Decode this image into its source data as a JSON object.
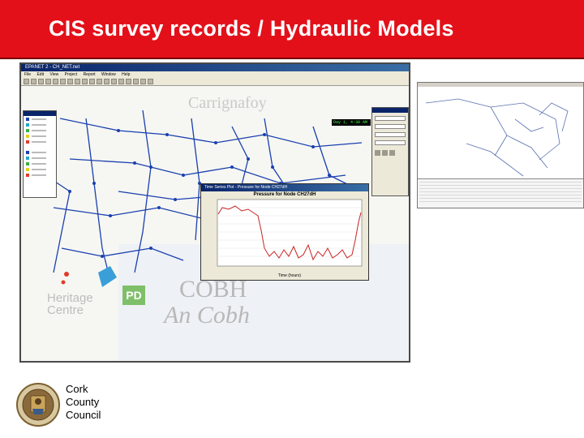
{
  "header": {
    "title": "CIS survey records / Hydraulic Models"
  },
  "app_window": {
    "title": "EPANET 2 - CH_NET.net",
    "menu": [
      "File",
      "Edit",
      "View",
      "Project",
      "Report",
      "Window",
      "Help"
    ],
    "status_readout": "Day 1, 4:30 AM",
    "plot_window_title": "Time Series Plot - Pressure for Node CH27dH",
    "plot_title": "Pressure for Node CH27dH",
    "plot_xlabel": "Time (hours)"
  },
  "map_labels": {
    "town_en": "COBH",
    "town_ga": "An Cobh",
    "heritage_line1": "Heritage",
    "heritage_line2": "Centre",
    "carrig": "Carrignafoy",
    "pd_badge": "PD"
  },
  "org": {
    "line1": "Cork",
    "line2": "County",
    "line3": "Council"
  },
  "colors": {
    "banner": "#e3101a",
    "plot_line": "#cc2222",
    "network": "#1a3fb0"
  }
}
